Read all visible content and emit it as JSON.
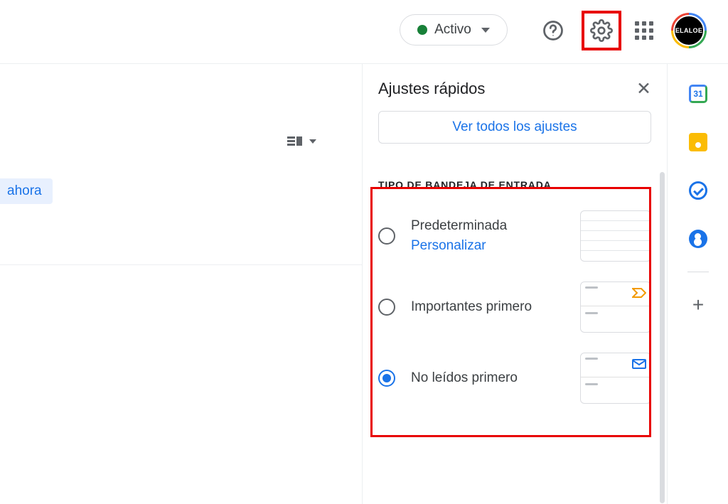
{
  "header": {
    "status_label": "Activo",
    "avatar_text": "ELALOE"
  },
  "mail": {
    "highlight_text": "ahora"
  },
  "panel": {
    "title": "Ajustes rápidos",
    "see_all": "Ver todos los ajustes",
    "section": "TIPO DE BANDEJA DE ENTRADA",
    "options": {
      "default": {
        "label": "Predeterminada",
        "customize": "Personalizar"
      },
      "important": {
        "label": "Importantes primero"
      },
      "unread": {
        "label": "No leídos primero"
      }
    }
  },
  "side": {
    "calendar_day": "31"
  }
}
